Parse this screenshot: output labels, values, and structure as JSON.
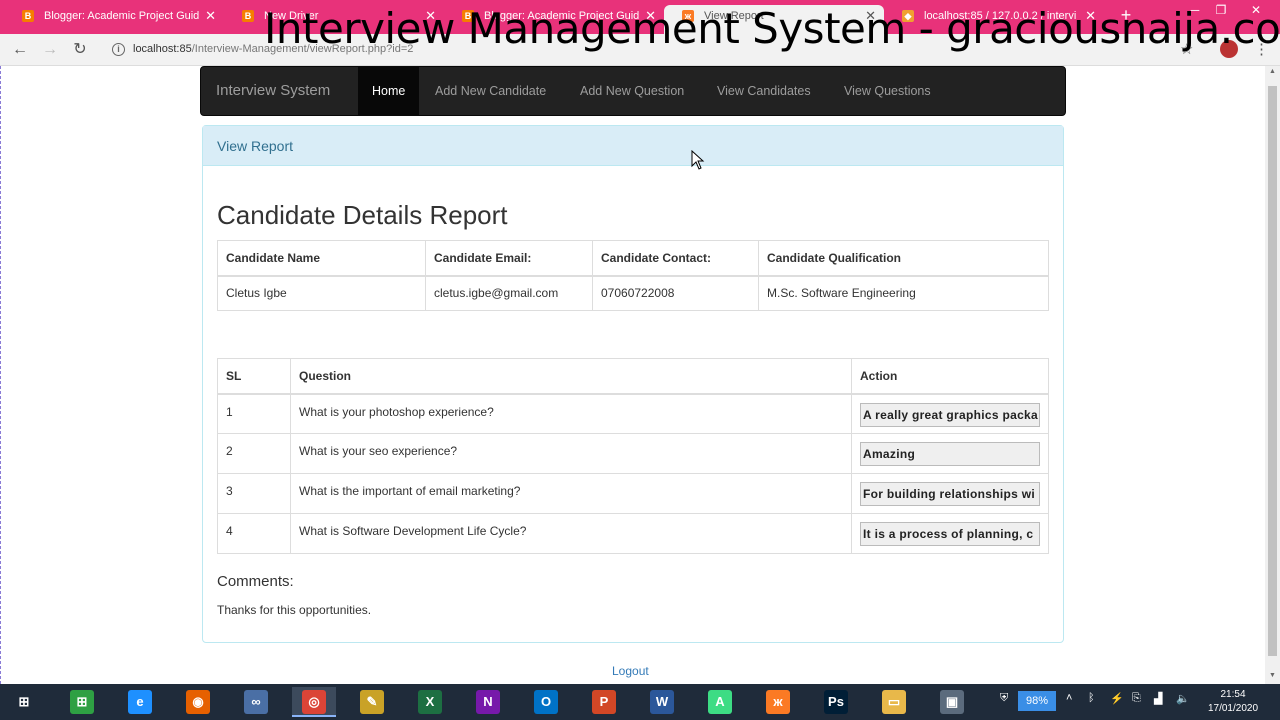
{
  "overlay": {
    "title": "Interview Management System - graciousnaija.com"
  },
  "browser": {
    "tabs": [
      {
        "label": "Blogger: Academic Project Guid",
        "icon": "blogger-icon",
        "color": "#f57d00"
      },
      {
        "label": "New Driver",
        "icon": "blogger-icon",
        "color": "#f57d00"
      },
      {
        "label": "Blogger: Academic Project Guid",
        "icon": "blogger-icon",
        "color": "#f57d00"
      },
      {
        "label": "View Report",
        "icon": "xampp-icon",
        "color": "#fb7a24"
      },
      {
        "label": "localhost:85 / 127.0.0.2 / intervi",
        "icon": "phpmyadmin-icon",
        "color": "#f0a030"
      }
    ],
    "active_tab_index": 3,
    "url_host": "localhost:85",
    "url_path": "/Interview-Management/viewReport.php?id=2"
  },
  "navbar": {
    "brand": "Interview System",
    "items": [
      "Home",
      "Add New Candidate",
      "Add New Question",
      "View Candidates",
      "View Questions"
    ],
    "active_index": 0
  },
  "panel": {
    "heading": "View Report"
  },
  "report": {
    "title": "Candidate Details Report",
    "candidate_headers": [
      "Candidate Name",
      "Candidate Email:",
      "Candidate Contact:",
      "Candidate Qualification"
    ],
    "candidate": {
      "name": "Cletus Igbe",
      "email": "cletus.igbe@gmail.com",
      "contact": "07060722008",
      "qualification": "M.Sc. Software Engineering"
    },
    "question_headers": [
      "SL",
      "Question",
      "Action"
    ],
    "questions": [
      {
        "sl": "1",
        "question": "What is your photoshop experience?",
        "answer": "A really great graphics packa"
      },
      {
        "sl": "2",
        "question": "What is your seo experience?",
        "answer": "Amazing"
      },
      {
        "sl": "3",
        "question": "What is the important of email marketing?",
        "answer": "For building relationships wi"
      },
      {
        "sl": "4",
        "question": "What is Software Development Life Cycle?",
        "answer": "It is a process of planning, c"
      }
    ],
    "comments_heading": "Comments:",
    "comments_text": "Thanks for this opportunities.",
    "logout": "Logout"
  },
  "taskbar": {
    "apps": [
      {
        "name": "windows-start-icon",
        "glyph": "⊞",
        "color": "#1f2b3a"
      },
      {
        "name": "store-icon",
        "glyph": "⊞",
        "color": "#2ea043"
      },
      {
        "name": "internet-explorer-icon",
        "glyph": "e",
        "color": "#1e90ff"
      },
      {
        "name": "firefox-icon",
        "glyph": "◉",
        "color": "#e66000"
      },
      {
        "name": "link-app-icon",
        "glyph": "∞",
        "color": "#4a6fa5"
      },
      {
        "name": "chrome-icon",
        "glyph": "◎",
        "color": "#db4437"
      },
      {
        "name": "tools-icon",
        "glyph": "✎",
        "color": "#c9a227"
      },
      {
        "name": "excel-icon",
        "glyph": "X",
        "color": "#1d6f42"
      },
      {
        "name": "onenote-icon",
        "glyph": "N",
        "color": "#7719aa"
      },
      {
        "name": "outlook-icon",
        "glyph": "O",
        "color": "#0072c6"
      },
      {
        "name": "powerpoint-icon",
        "glyph": "P",
        "color": "#d24726"
      },
      {
        "name": "word-icon",
        "glyph": "W",
        "color": "#2b579a"
      },
      {
        "name": "android-studio-icon",
        "glyph": "A",
        "color": "#3ddc84"
      },
      {
        "name": "xampp-icon",
        "glyph": "ж",
        "color": "#fb7a24"
      },
      {
        "name": "photoshop-icon",
        "glyph": "Ps",
        "color": "#001e36"
      },
      {
        "name": "file-explorer-icon",
        "glyph": "▭",
        "color": "#e8b84a"
      },
      {
        "name": "screen-recorder-icon",
        "glyph": "▣",
        "color": "#5b6b7d"
      }
    ],
    "battery": "98%",
    "time": "21:54",
    "date": "17/01/2020"
  }
}
